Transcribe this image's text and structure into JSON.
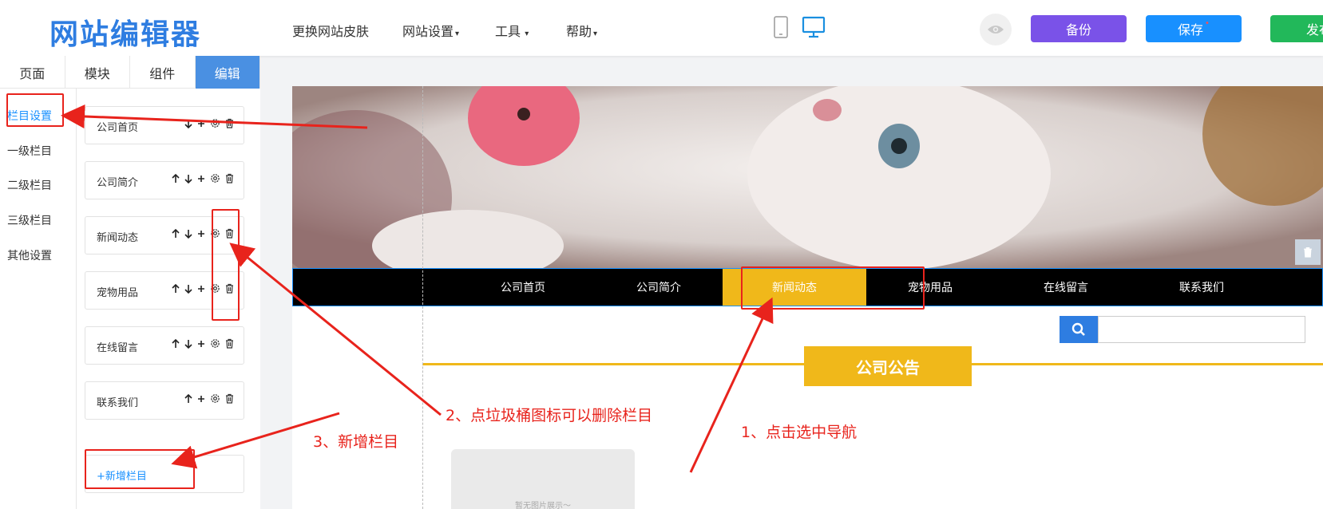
{
  "header": {
    "logo": "网站编辑器",
    "menu": [
      {
        "label": "更换网站皮肤",
        "caret": ""
      },
      {
        "label": "网站设置",
        "caret": "▾"
      },
      {
        "label": "工具",
        "caret": " ▾"
      },
      {
        "label": "帮助",
        "caret": "▾"
      }
    ],
    "backup": "备份",
    "save": "保存",
    "save_dot": "•",
    "publish": "发布"
  },
  "tabs": [
    "页面",
    "模块",
    "组件",
    "编辑"
  ],
  "subnav": [
    "栏目设置",
    "一级栏目",
    "二级栏目",
    "三级栏目",
    "其他设置"
  ],
  "columns": [
    {
      "label": "公司首页"
    },
    {
      "label": "公司简介"
    },
    {
      "label": "新闻动态"
    },
    {
      "label": "宠物用品"
    },
    {
      "label": "在线留言"
    },
    {
      "label": "联系我们"
    }
  ],
  "add_column": "+新增栏目",
  "preview": {
    "nav": [
      "公司首页",
      "公司简介",
      "新闻动态",
      "宠物用品",
      "在线留言",
      "联系我们"
    ],
    "notice_title": "公司公告",
    "placeholder_text": "暂无图片展示～"
  },
  "annotations": {
    "step1": "1、点击选中导航",
    "step2": "2、点垃圾桶图标可以删除栏目",
    "step3": "3、新增栏目"
  },
  "colors": {
    "accent": "#1890ff",
    "logo": "#2e7de1",
    "backup": "#7a52e8",
    "publish": "#22b85a",
    "nav_active": "#f0b81a",
    "annotation": "#e8231c"
  }
}
